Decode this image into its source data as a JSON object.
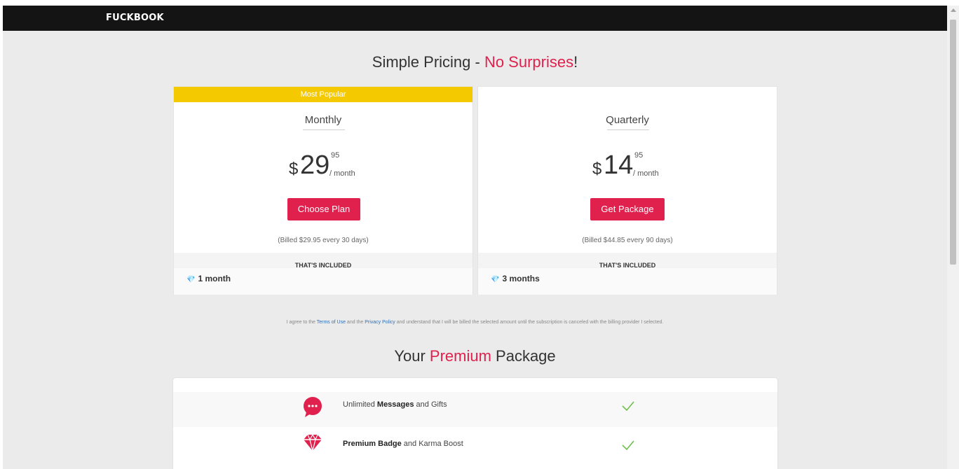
{
  "header": {
    "logo": "FUCKBOOK"
  },
  "pricing": {
    "heading_main": "Simple Pricing - ",
    "heading_accent": "No Surprises",
    "heading_end": "!",
    "plans": [
      {
        "ribbon": "Most Popular",
        "name": "Monthly",
        "currency": "$",
        "price_whole": "29",
        "price_cents": "95",
        "per": "/ month",
        "button": "Choose Plan",
        "billed": "(Billed $29.95 every 30 days)",
        "included_title": "THAT'S INCLUDED",
        "included_item": "1 month"
      },
      {
        "name": "Quarterly",
        "currency": "$",
        "price_whole": "14",
        "price_cents": "95",
        "per": "/ month",
        "button": "Get Package",
        "billed": "(Billed $44.85 every 90 days)",
        "included_title": "THAT'S INCLUDED",
        "included_item": "3 months"
      }
    ]
  },
  "legal": {
    "before": "I agree to the ",
    "terms_link": "Terms of Use",
    "middle": " and the ",
    "privacy_link": "Privacy Policy",
    "after": " and understand that I will be billed the selected amount until the subscription is canceled with the billing provider I selected."
  },
  "premium": {
    "heading_start": "Your ",
    "heading_accent": "Premium",
    "heading_end": " Package",
    "features": [
      {
        "icon": "chat-bubble-icon",
        "pre": "Unlimited ",
        "bold": "Messages",
        "post": " and Gifts"
      },
      {
        "icon": "diamond-icon",
        "pre": "",
        "bold": "Premium Badge",
        "post": " and Karma Boost"
      }
    ]
  },
  "colors": {
    "accent": "#e0204d",
    "ribbon": "#f5c900",
    "check": "#6cc04a",
    "topbar": "#141414"
  }
}
